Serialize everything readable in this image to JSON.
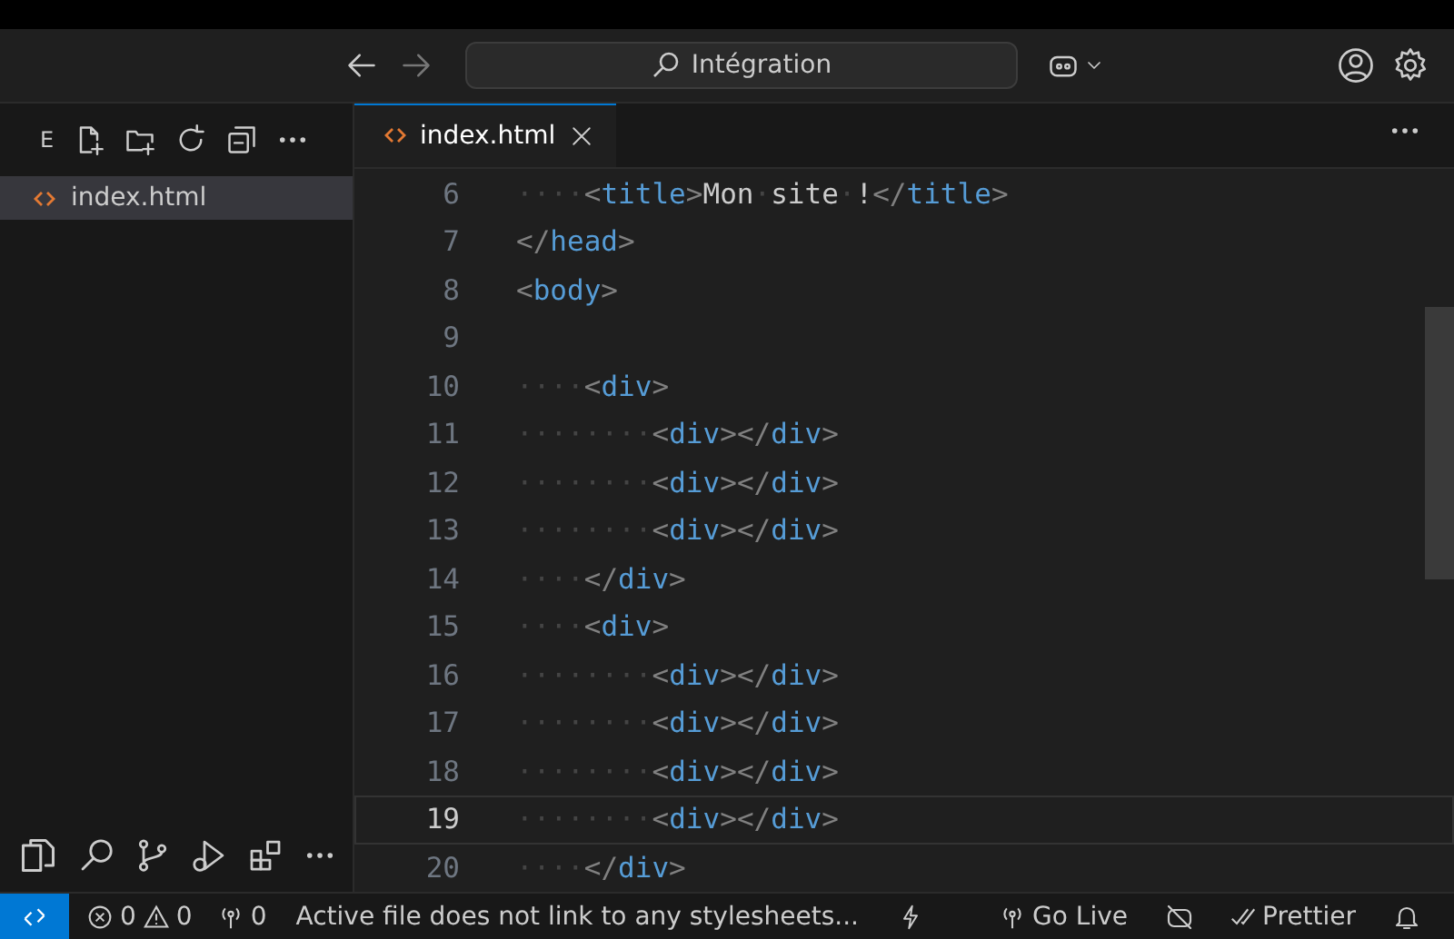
{
  "titlebar": {
    "search": "Intégration"
  },
  "explorer": {
    "title": "E",
    "files": [
      {
        "name": "index.html",
        "selected": true
      }
    ]
  },
  "tabs": [
    {
      "label": "index.html",
      "selected": true
    }
  ],
  "editor": {
    "lines": [
      {
        "number": "6",
        "code": "····<title>Mon·site·!</title>",
        "selected": false
      },
      {
        "number": "7",
        "code": "</head>",
        "selected": false
      },
      {
        "number": "8",
        "code": "<body>",
        "selected": false
      },
      {
        "number": "9",
        "selected": false
      },
      {
        "number": "10",
        "code": "····<div>",
        "selected": false
      },
      {
        "number": "11",
        "code": "········<div></div>",
        "selected": false
      },
      {
        "number": "12",
        "code": "········<div></div>",
        "selected": false
      },
      {
        "number": "13",
        "code": "········<div></div>",
        "selected": false
      },
      {
        "number": "14",
        "code": "····</div>",
        "selected": false
      },
      {
        "number": "15",
        "code": "····<div>",
        "selected": false
      },
      {
        "number": "16",
        "code": "········<div></div>",
        "selected": false
      },
      {
        "number": "17",
        "code": "········<div></div>",
        "selected": false
      },
      {
        "number": "18",
        "code": "········<div></div>",
        "selected": false
      },
      {
        "number": "19",
        "code": "········<div></div>",
        "selected": true
      },
      {
        "number": "20",
        "code": "····</div>",
        "selected": false
      }
    ]
  },
  "status_bar": {
    "errors": "0",
    "warnings": "0",
    "ports": "0",
    "message": "Active file does not link to any stylesheets...",
    "golive": "Go Live",
    "prettier": "Prettier"
  }
}
